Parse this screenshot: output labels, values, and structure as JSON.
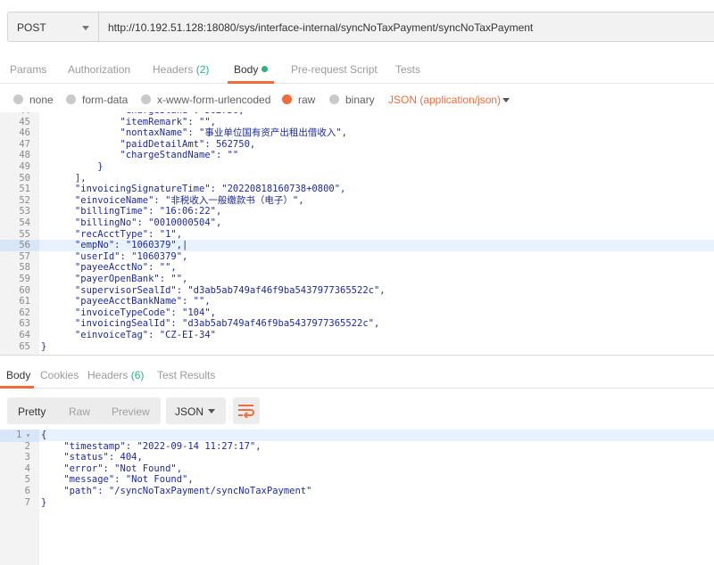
{
  "request": {
    "method": "POST",
    "url": "http://10.192.51.128:18080/sys/interface-internal/syncNoTaxPayment/syncNoTaxPayment"
  },
  "request_tabs": [
    {
      "label": "Params"
    },
    {
      "label": "Authorization"
    },
    {
      "label": "Headers",
      "count": "(2)"
    },
    {
      "label": "Body"
    },
    {
      "label": "Pre-request Script"
    },
    {
      "label": "Tests"
    }
  ],
  "body_types": [
    "none",
    "form-data",
    "x-www-form-urlencoded",
    "raw",
    "binary"
  ],
  "body_format": "JSON (application/json)",
  "request_body_lines": [
    {
      "n": "45",
      "code": "              \"itemRemark\": \"\","
    },
    {
      "n": "46",
      "code": "              \"nontaxName\": \"事业单位国有资产出租出借收入\","
    },
    {
      "n": "47",
      "code": "              \"paidDetailAmt\": 562750,"
    },
    {
      "n": "48",
      "code": "              \"chargeStandName\": \"\""
    },
    {
      "n": "49",
      "code": "          }"
    },
    {
      "n": "50",
      "code": "      ],"
    },
    {
      "n": "51",
      "code": "      \"invoicingSignatureTime\": \"20220818160738+0800\","
    },
    {
      "n": "52",
      "code": "      \"einvoiceName\": \"非税收入一般缴款书（电子）\","
    },
    {
      "n": "53",
      "code": "      \"billingTime\": \"16:06:22\","
    },
    {
      "n": "54",
      "code": "      \"billingNo\": \"0010000504\","
    },
    {
      "n": "55",
      "code": "      \"recAcctType\": \"1\","
    },
    {
      "n": "56",
      "code": "      \"empNo\": \"1060379\",|"
    },
    {
      "n": "57",
      "code": "      \"userId\": \"1060379\","
    },
    {
      "n": "58",
      "code": "      \"payeeAcctNo\": \"\","
    },
    {
      "n": "59",
      "code": "      \"payerOpenBank\": \"\","
    },
    {
      "n": "60",
      "code": "      \"supervisorSealId\": \"d3ab5ab749af46f9ba5437977365522c\","
    },
    {
      "n": "61",
      "code": "      \"payeeAcctBankName\": \"\","
    },
    {
      "n": "62",
      "code": "      \"invoiceTypeCode\": \"104\","
    },
    {
      "n": "63",
      "code": "      \"invoicingSealId\": \"d3ab5ab749af46f9ba5437977365522c\","
    },
    {
      "n": "64",
      "code": "      \"einvoiceTag\": \"CZ-EI-34\""
    },
    {
      "n": "65",
      "code": "}"
    }
  ],
  "response_tabs": [
    {
      "label": "Body"
    },
    {
      "label": "Cookies"
    },
    {
      "label": "Headers",
      "count": "(6)"
    },
    {
      "label": "Test Results"
    }
  ],
  "response_view_modes": [
    "Pretty",
    "Raw",
    "Preview"
  ],
  "response_format": "JSON",
  "response_body_lines": [
    {
      "n": "1",
      "code": "{"
    },
    {
      "n": "2",
      "code": "    \"timestamp\": \"2022-09-14 11:27:17\","
    },
    {
      "n": "3",
      "code": "    \"status\": 404,"
    },
    {
      "n": "4",
      "code": "    \"error\": \"Not Found\","
    },
    {
      "n": "5",
      "code": "    \"message\": \"Not Found\","
    },
    {
      "n": "6",
      "code": "    \"path\": \"/syncNoTaxPayment/syncNoTaxPayment\""
    },
    {
      "n": "7",
      "code": "}"
    }
  ],
  "colors": {
    "accent": "#f26b3a",
    "count_green": "#26b47f",
    "code_text": "#1e2a9c"
  },
  "icons": [
    "chevron-down-icon",
    "wrap-text-icon",
    "fold-arrow-icon"
  ]
}
